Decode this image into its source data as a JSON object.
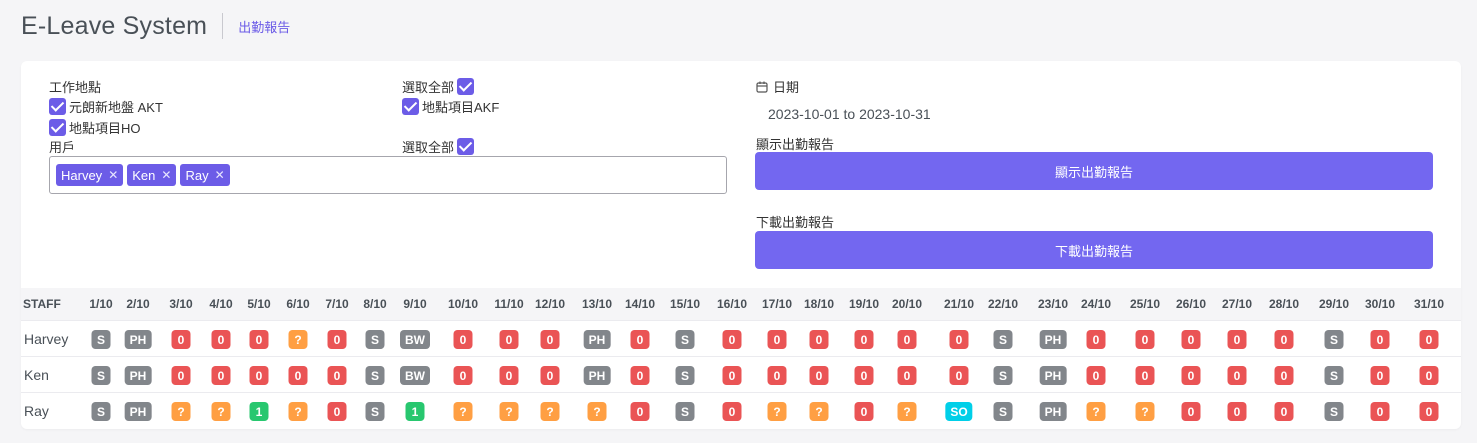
{
  "header": {
    "title": "E-Leave System",
    "breadcrumb": "出勤報告"
  },
  "filters": {
    "location_label": "工作地點",
    "select_all_label": "選取全部",
    "locations": [
      "元朗新地盤 AKT",
      "地點項目HO",
      "地點項目AKF"
    ],
    "user_label": "用戶",
    "users_select_all_label": "選取全部",
    "users": [
      "Harvey",
      "Ken",
      "Ray"
    ],
    "date_label": "日期",
    "date_range": "2023-10-01 to 2023-10-31",
    "show_section_label": "顯示出勤報告",
    "show_button": "顯示出勤報告",
    "download_section_label": "下載出勤報告",
    "download_button": "下載出勤報告"
  },
  "status_colors": {
    "S": "#82868b",
    "PH": "#82868b",
    "BW": "#82868b",
    "0": "#ea5455",
    "?": "#ff9f43",
    "1": "#28c76f",
    "SO": "#00cfe8"
  },
  "table": {
    "staff_header": "STAFF",
    "days": [
      "1/10",
      "2/10",
      "3/10",
      "4/10",
      "5/10",
      "6/10",
      "7/10",
      "8/10",
      "9/10",
      "10/10",
      "11/10",
      "12/10",
      "13/10",
      "14/10",
      "15/10",
      "16/10",
      "17/10",
      "18/10",
      "19/10",
      "20/10",
      "21/10",
      "22/10",
      "23/10",
      "24/10",
      "25/10",
      "26/10",
      "27/10",
      "28/10",
      "29/10",
      "30/10",
      "31/10"
    ],
    "rows": [
      {
        "name": "Harvey",
        "cells": [
          "S",
          "PH",
          "0",
          "0",
          "0",
          "?",
          "0",
          "S",
          "BW",
          "0",
          "0",
          "0",
          "PH",
          "0",
          "S",
          "0",
          "0",
          "0",
          "0",
          "0",
          "0",
          "S",
          "PH",
          "0",
          "0",
          "0",
          "0",
          "0",
          "S",
          "0",
          "0"
        ]
      },
      {
        "name": "Ken",
        "cells": [
          "S",
          "PH",
          "0",
          "0",
          "0",
          "0",
          "0",
          "S",
          "BW",
          "0",
          "0",
          "0",
          "PH",
          "0",
          "S",
          "0",
          "0",
          "0",
          "0",
          "0",
          "0",
          "S",
          "PH",
          "0",
          "0",
          "0",
          "0",
          "0",
          "S",
          "0",
          "0"
        ]
      },
      {
        "name": "Ray",
        "cells": [
          "S",
          "PH",
          "?",
          "?",
          "1",
          "?",
          "0",
          "S",
          "1",
          "?",
          "?",
          "?",
          "?",
          "0",
          "S",
          "0",
          "?",
          "?",
          "0",
          "?",
          "SO",
          "S",
          "PH",
          "?",
          "?",
          "0",
          "0",
          "0",
          "S",
          "0",
          "0"
        ]
      }
    ]
  }
}
